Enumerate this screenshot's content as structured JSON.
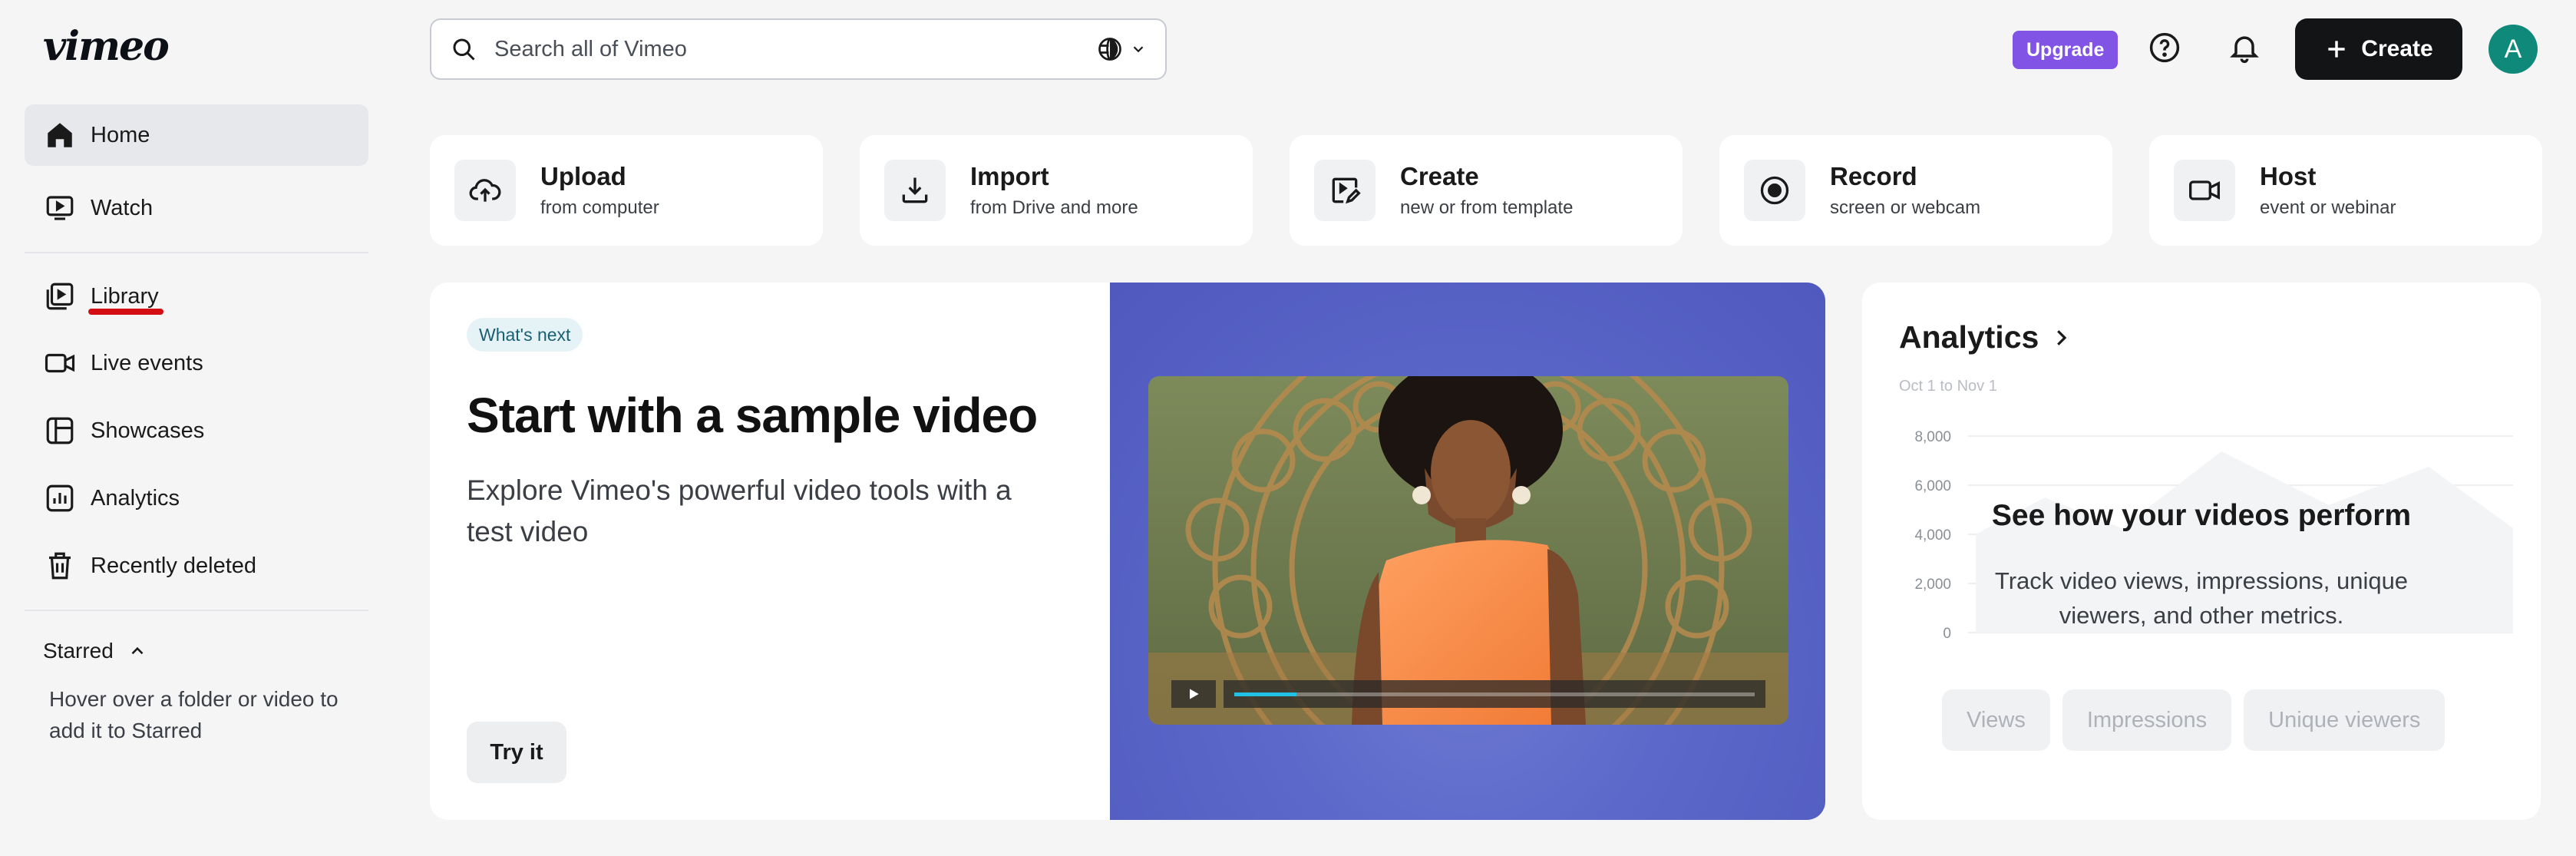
{
  "brand": {
    "logo": "vimeo"
  },
  "sidebar": {
    "items": [
      {
        "label": "Home",
        "icon": "home-icon"
      },
      {
        "label": "Watch",
        "icon": "watch-icon"
      },
      {
        "label": "Library",
        "icon": "library-icon"
      },
      {
        "label": "Live events",
        "icon": "live-events-icon"
      },
      {
        "label": "Showcases",
        "icon": "showcases-icon"
      },
      {
        "label": "Analytics",
        "icon": "analytics-icon"
      },
      {
        "label": "Recently deleted",
        "icon": "trash-icon"
      }
    ],
    "active": "Home",
    "starred": {
      "label": "Starred",
      "help": "Hover over a folder or video to add it to Starred"
    }
  },
  "topbar": {
    "search_placeholder": "Search all of Vimeo",
    "upgrade_label": "Upgrade",
    "create_label": "Create",
    "avatar_initial": "A"
  },
  "actions": [
    {
      "title": "Upload",
      "subtitle": "from computer",
      "icon": "upload-cloud-icon"
    },
    {
      "title": "Import",
      "subtitle": "from Drive and more",
      "icon": "import-icon"
    },
    {
      "title": "Create",
      "subtitle": "new or from template",
      "icon": "create-template-icon"
    },
    {
      "title": "Record",
      "subtitle": "screen or webcam",
      "icon": "record-icon"
    },
    {
      "title": "Host",
      "subtitle": "event or webinar",
      "icon": "host-camera-icon"
    }
  ],
  "hero": {
    "badge": "What's next",
    "title": "Start with a sample video",
    "subtitle": "Explore Vimeo's powerful video tools with a test video",
    "cta": "Try it",
    "video_progress": 0.12
  },
  "analytics": {
    "title": "Analytics",
    "date_range": "Oct 1 to Nov 1",
    "y_ticks": [
      "8,000",
      "6,000",
      "4,000",
      "2,000",
      "0"
    ],
    "overlay_title": "See how your videos perform",
    "overlay_sub": "Track video views, impressions, unique viewers, and other metrics.",
    "tabs": [
      "Views",
      "Impressions",
      "Unique viewers"
    ]
  },
  "colors": {
    "accent": "#8254e6",
    "create_bg": "#131416",
    "avatar": "#0f8a7a",
    "video_panel": "#5b67c9",
    "scrub_fill": "#21c1e6"
  }
}
